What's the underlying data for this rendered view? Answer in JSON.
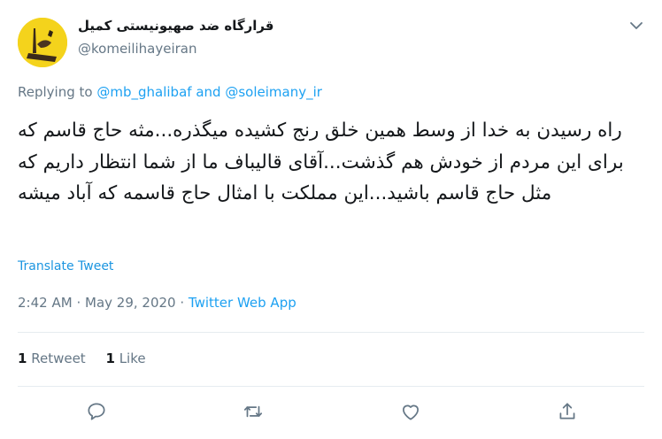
{
  "tweet": {
    "display_name": "قرارگاه ضد صهیونیستی کمیل",
    "handle": "@komeilihayeiran",
    "replying_prefix": "Replying to",
    "reply_to_1": "@mb_ghalibaf",
    "reply_and": "and",
    "reply_to_2": "@soleimany_ir",
    "text": "راه رسیدن به خدا از وسط همین خلق رنج کشیده میگذره...مثه حاج قاسم که برای این مردم از خودش هم گذشت...آقای قالیباف ما از شما انتظار داریم که مثل حاج قاسم باشید...این مملکت با امثال حاج قاسمه که آباد میشه",
    "translate_label": "Translate Tweet",
    "time": "2:42 AM",
    "date": "May 29, 2020",
    "separator": "·",
    "source": "Twitter Web App",
    "retweet_count": "1",
    "retweet_label": "Retweet",
    "like_count": "1",
    "like_label": "Like"
  },
  "icons": {
    "menu": "chevron-down-icon",
    "reply": "reply-icon",
    "retweet": "retweet-icon",
    "like": "heart-icon",
    "share": "share-icon"
  },
  "colors": {
    "link": "#1da1f2",
    "muted": "#657786",
    "text": "#14171a",
    "avatar_bg": "#f4d31c"
  }
}
